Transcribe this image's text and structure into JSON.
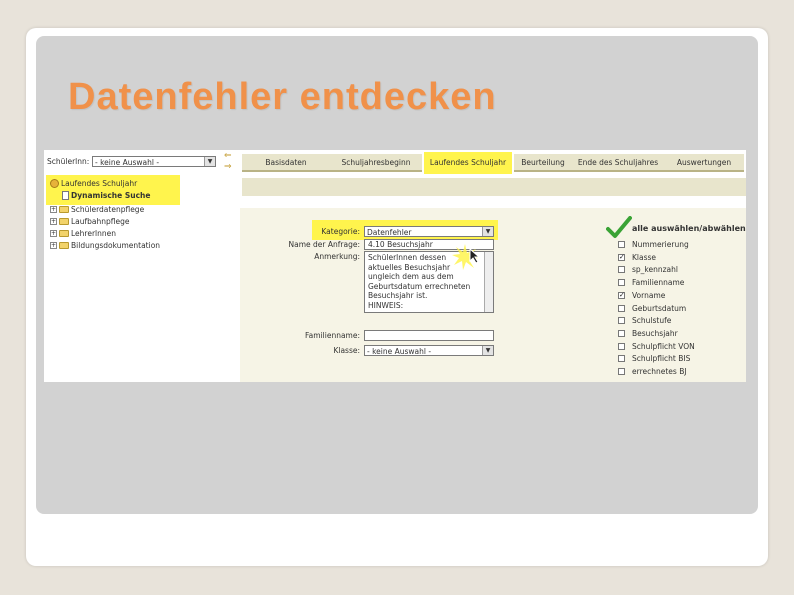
{
  "slide": {
    "title": "Datenfehler entdecken"
  },
  "app": {
    "toolbar": {
      "selection_label": "Schülerlnn:",
      "selection_value": "- keine Auswahl -"
    },
    "tabs": [
      {
        "label": "Basisdaten",
        "active": false
      },
      {
        "label": "Schuljahresbeginn",
        "active": false
      },
      {
        "label": "Laufendes Schuljahr",
        "active": true
      },
      {
        "label": "Beurteilung",
        "active": false
      },
      {
        "label": "Ende des Schuljahres",
        "active": false
      },
      {
        "label": "Auswertungen",
        "active": false
      }
    ],
    "tree": [
      {
        "label": "Laufendes Schuljahr",
        "level": 0,
        "icon": "globe-icon"
      },
      {
        "label": "Dynamische Suche",
        "level": 1,
        "icon": "document-icon"
      },
      {
        "label": "Schülerdatenpflege",
        "level": 0,
        "icon": "folder-icon"
      },
      {
        "label": "Laufbahnpflege",
        "level": 0,
        "icon": "folder-icon"
      },
      {
        "label": "Lehrerlnnen",
        "level": 0,
        "icon": "folder-icon"
      },
      {
        "label": "Bildungsdokumentation",
        "level": 0,
        "icon": "folder-icon"
      }
    ],
    "form": {
      "kategorie_label": "Kategorie:",
      "kategorie_value": "Datenfehler",
      "name_label": "Name der Anfrage:",
      "name_value": "4.10 Besuchsjahr",
      "anmerkung_label": "Anmerkung:",
      "anmerkung_lines": [
        "Schülerlnnen dessen",
        "aktuelles Besuchsjahr",
        "ungleich dem aus dem",
        "Geburtsdatum errechneten",
        "Besuchsjahr ist.",
        "HINWEIS:"
      ],
      "familienname_label": "Familienname:",
      "familienname_value": "",
      "klasse_label": "Klasse:",
      "klasse_value": "- keine Auswahl -"
    },
    "fields": {
      "header": "alle auswählen/abwählen",
      "items": [
        {
          "label": "Nummerierung",
          "checked": false
        },
        {
          "label": "Klasse",
          "checked": true
        },
        {
          "label": "sp_kennzahl",
          "checked": false
        },
        {
          "label": "Familienname",
          "checked": false
        },
        {
          "label": "Vorname",
          "checked": true
        },
        {
          "label": "Geburtsdatum",
          "checked": false
        },
        {
          "label": "Schulstufe",
          "checked": false
        },
        {
          "label": "Besuchsjahr",
          "checked": false
        },
        {
          "label": "Schulpflicht VON",
          "checked": false
        },
        {
          "label": "Schulpflicht BIS",
          "checked": false
        },
        {
          "label": "errechnetes BJ",
          "checked": false
        }
      ]
    },
    "colors": {
      "highlight": "#fff44d",
      "title": "#f0914a",
      "check_green": "#3aa335"
    }
  }
}
